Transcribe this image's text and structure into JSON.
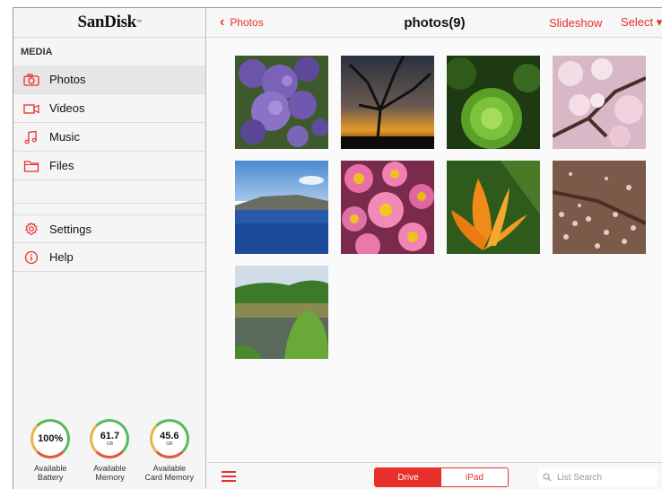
{
  "app": {
    "logo": "SanDisk",
    "trademark": "™"
  },
  "sidebar": {
    "section": "MEDIA",
    "items": [
      {
        "label": "Photos",
        "icon": "camera-icon"
      },
      {
        "label": "Videos",
        "icon": "video-icon"
      },
      {
        "label": "Music",
        "icon": "music-icon"
      },
      {
        "label": "Files",
        "icon": "folder-icon"
      }
    ],
    "extra": [
      {
        "label": "Settings",
        "icon": "gear-icon"
      },
      {
        "label": "Help",
        "icon": "info-icon"
      }
    ]
  },
  "gauges": [
    {
      "value": "100%",
      "unit": "",
      "label1": "Available",
      "label2": "Battery"
    },
    {
      "value": "61.7",
      "unit": "GB",
      "label1": "Available",
      "label2": "Memory"
    },
    {
      "value": "45.6",
      "unit": "GB",
      "label1": "Available",
      "label2": "Card Memory"
    }
  ],
  "header": {
    "back": "Photos",
    "title": "photos(9)",
    "slideshow": "Slideshow",
    "select": "Select"
  },
  "photos": [
    {
      "name": "purple-flowers"
    },
    {
      "name": "tree-sunset"
    },
    {
      "name": "green-succulent"
    },
    {
      "name": "cherry-blossom"
    },
    {
      "name": "lake-island"
    },
    {
      "name": "pink-daisies"
    },
    {
      "name": "orange-lily"
    },
    {
      "name": "petals-ground"
    },
    {
      "name": "meadow-pond"
    }
  ],
  "footer": {
    "drive": "Drive",
    "ipad": "iPad",
    "search_placeholder": "List Search"
  },
  "colors": {
    "accent": "#e8302a"
  }
}
